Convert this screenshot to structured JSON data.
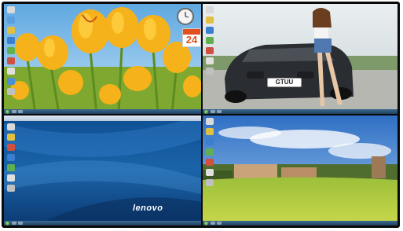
{
  "screens": [
    {
      "name": "tulips-desktop",
      "wallpaper": "yellow-tulips",
      "clock_gadget": "clock-icon",
      "calendar_day": "24"
    },
    {
      "name": "car-desktop",
      "wallpaper": "car-and-model",
      "plate_text": "GTUU"
    },
    {
      "name": "lenovo-desktop",
      "wallpaper": "blue-waves",
      "brand_text": "lenovo"
    },
    {
      "name": "castle-desktop",
      "wallpaper": "castle-landscape"
    }
  ],
  "colors": {
    "frame": "#0a0a0a",
    "taskbar": "#2c5478",
    "calendar_accent": "#e3501f",
    "lenovo_blue": "#1b63a8",
    "tulip_yellow": "#f6b21a",
    "sky_blue": "#3a78c8"
  }
}
